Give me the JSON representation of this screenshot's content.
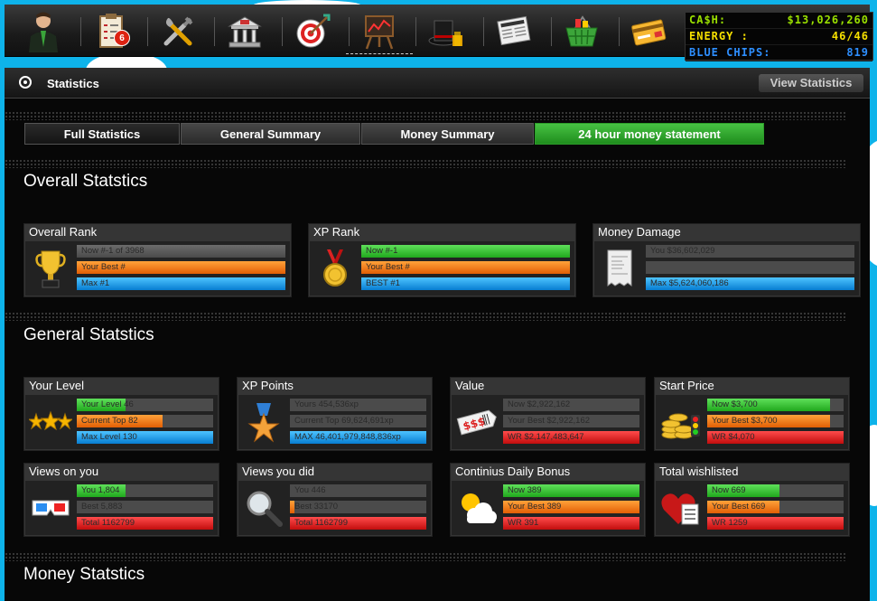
{
  "top_stats": {
    "cash_label": "CA$H:",
    "cash_value": "$13,026,260",
    "energy_label": "ENERGY :",
    "energy_value": "46/46",
    "chips_label": "BLUE CHIPS:",
    "chips_value": "819"
  },
  "nav": {
    "badge_count": "6",
    "icons": [
      "profile-icon",
      "tasks-icon",
      "tools-icon",
      "bank-icon",
      "target-icon",
      "stock-chart-icon",
      "magic-hat-icon",
      "newspaper-icon",
      "shopping-basket-icon",
      "credit-card-icon"
    ]
  },
  "page": {
    "title": "Statistics",
    "view_button": "View Statistics"
  },
  "tabs": [
    "Full Statistics",
    "General Summary",
    "Money Summary",
    "24 hour money statement"
  ],
  "sections": {
    "overall": "Overall Statstics",
    "general": "General Statstics",
    "money": "Money Statstics"
  },
  "overall_cards": [
    {
      "title": "Overall Rank",
      "icon": "trophy-icon",
      "bars": [
        {
          "label": "Now #-1 of 3968",
          "color": "grey",
          "fill": 1.0
        },
        {
          "label": "Your Best #",
          "color": "orange",
          "fill": 1.0
        },
        {
          "label": "Max #1",
          "color": "blue",
          "fill": 1.0
        }
      ]
    },
    {
      "title": "XP Rank",
      "icon": "medal-icon",
      "bars": [
        {
          "label": "Now #-1",
          "color": "green",
          "fill": 1.0
        },
        {
          "label": "Your Best #",
          "color": "orange",
          "fill": 1.0
        },
        {
          "label": "BEST #1",
          "color": "blue",
          "fill": 1.0
        }
      ]
    },
    {
      "title": "Money Damage",
      "icon": "receipt-icon",
      "bars": [
        {
          "label": "You $36,602,029",
          "color": "grey",
          "fill": 0.0
        },
        {
          "label": "",
          "color": "grey",
          "fill": 0.0
        },
        {
          "label": "Max $5,624,060,186",
          "color": "blue",
          "fill": 1.0
        }
      ]
    }
  ],
  "general_cards": [
    {
      "title": "Your Level",
      "icon": "stars-icon",
      "bars": [
        {
          "label": "Your Level 46",
          "color": "green",
          "fill": 0.36
        },
        {
          "label": "Current Top 82",
          "color": "orange",
          "fill": 0.63
        },
        {
          "label": "Max Level 130",
          "color": "blue",
          "fill": 1.0
        }
      ]
    },
    {
      "title": "XP Points",
      "icon": "star-badge-icon",
      "bars": [
        {
          "label": "Yours 454,536xp",
          "color": "grey",
          "fill": 0.0
        },
        {
          "label": "Current Top 69,624,691xp",
          "color": "grey",
          "fill": 0.0
        },
        {
          "label": "MAX 46,401,979,848,836xp",
          "color": "blue",
          "fill": 1.0
        }
      ]
    },
    {
      "title": "Value",
      "icon": "price-tag-icon",
      "bars": [
        {
          "label": "Now $2,922,162",
          "color": "grey",
          "fill": 0.0
        },
        {
          "label": "Your Best $2,922,162",
          "color": "grey",
          "fill": 0.0
        },
        {
          "label": "WR $2,147,483,647",
          "color": "red",
          "fill": 1.0
        }
      ]
    },
    {
      "title": "Start Price",
      "icon": "coins-icon",
      "bars": [
        {
          "label": "Now $3,700",
          "color": "green",
          "fill": 0.9
        },
        {
          "label": "Your Best $3,700",
          "color": "orange",
          "fill": 0.9
        },
        {
          "label": "WR $4,070",
          "color": "red",
          "fill": 1.0
        }
      ]
    },
    {
      "title": "Views on you",
      "icon": "3d-glasses-icon",
      "bars": [
        {
          "label": "You 1,804",
          "color": "green",
          "fill": 0.36
        },
        {
          "label": "Best 5,883",
          "color": "grey",
          "fill": 0.0
        },
        {
          "label": "Total 1162799",
          "color": "red",
          "fill": 1.0
        }
      ]
    },
    {
      "title": "Views you did",
      "icon": "magnifier-icon",
      "bars": [
        {
          "label": "You 446",
          "color": "grey",
          "fill": 0.0
        },
        {
          "label": "Best 33170",
          "color": "orange",
          "fill": 0.03
        },
        {
          "label": "Total 1162799",
          "color": "red",
          "fill": 1.0
        }
      ]
    },
    {
      "title": "Continius Daily Bonus",
      "icon": "sun-cloud-icon",
      "bars": [
        {
          "label": "Now 389",
          "color": "green",
          "fill": 1.0
        },
        {
          "label": "Your Best 389",
          "color": "orange",
          "fill": 1.0
        },
        {
          "label": "WR 391",
          "color": "red",
          "fill": 1.0
        }
      ]
    },
    {
      "title": "Total wishlisted",
      "icon": "heart-list-icon",
      "bars": [
        {
          "label": "Now 669",
          "color": "green",
          "fill": 0.53
        },
        {
          "label": "Your Best 669",
          "color": "orange",
          "fill": 0.53
        },
        {
          "label": "WR 1259",
          "color": "red",
          "fill": 1.0
        }
      ]
    }
  ]
}
